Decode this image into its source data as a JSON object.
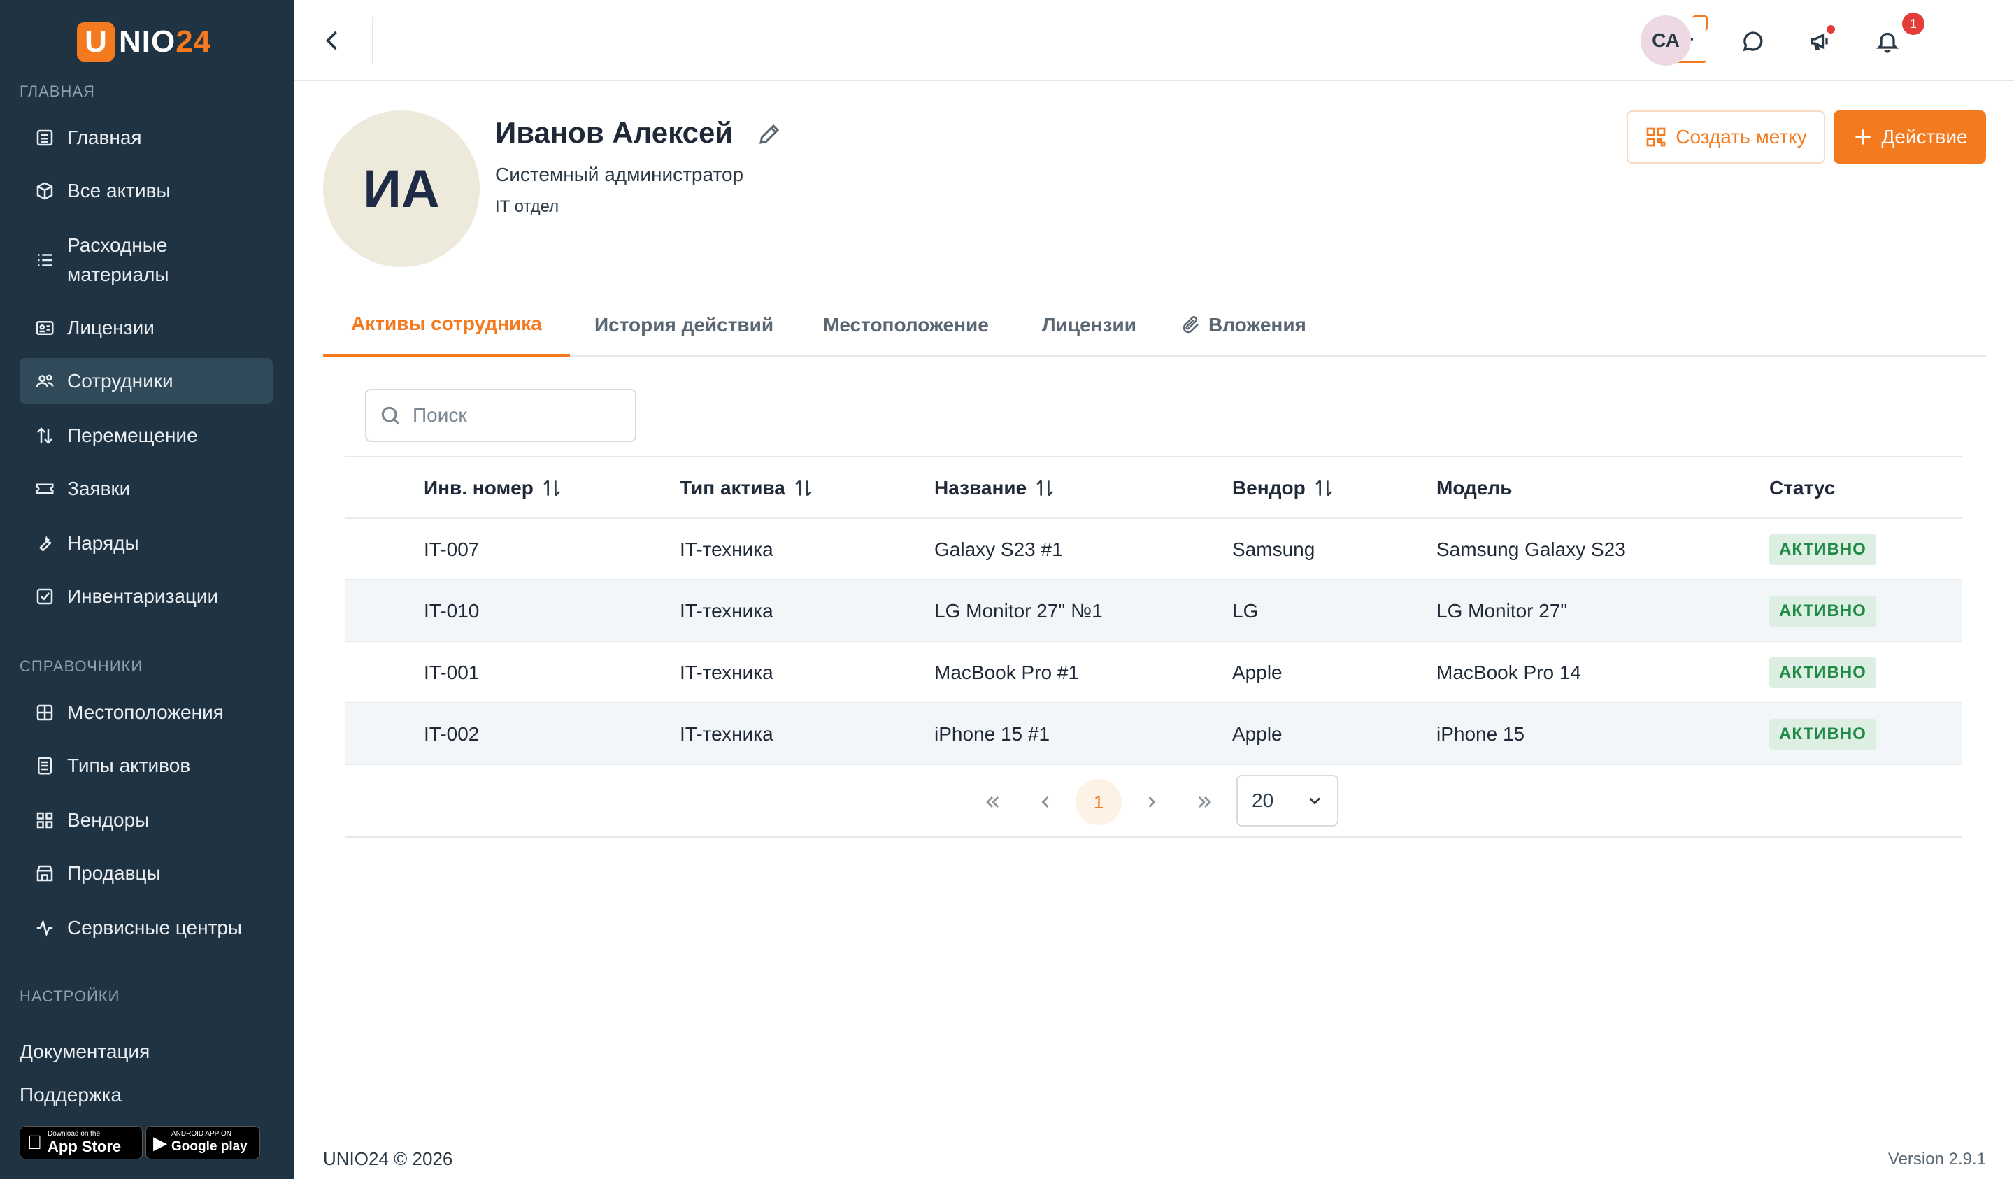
{
  "app": {
    "logo_letter": "U",
    "logo_rest": "NIO",
    "logo_num": "24"
  },
  "sidebar": {
    "section_main": "ГЛАВНАЯ",
    "section_refs": "СПРАВОЧНИКИ",
    "section_settings": "НАСТРОЙКИ",
    "main_items": [
      {
        "label": "Главная",
        "icon": "building-icon"
      },
      {
        "label": "Все активы",
        "icon": "box-icon"
      },
      {
        "label": "Расходные материалы",
        "icon": "list-icon"
      },
      {
        "label": "Лицензии",
        "icon": "license-icon"
      },
      {
        "label": "Сотрудники",
        "icon": "users-icon",
        "active": true
      },
      {
        "label": "Перемещение",
        "icon": "transfer-icon"
      },
      {
        "label": "Заявки",
        "icon": "ticket-icon"
      },
      {
        "label": "Наряды",
        "icon": "wrench-icon"
      },
      {
        "label": "Инвентаризации",
        "icon": "checkbox-icon"
      }
    ],
    "ref_items": [
      {
        "label": "Местоположения",
        "icon": "grid-icon"
      },
      {
        "label": "Типы активов",
        "icon": "document-icon"
      },
      {
        "label": "Вендоры",
        "icon": "tiles-icon"
      },
      {
        "label": "Продавцы",
        "icon": "store-icon"
      },
      {
        "label": "Сервисные центры",
        "icon": "activity-icon"
      }
    ],
    "docs_link": "Документация",
    "support_link": "Поддержка",
    "appstore_small": "Download on the",
    "appstore_big": "App Store",
    "googleplay_small": "ANDROID APP ON",
    "googleplay_big": "Google play"
  },
  "topbar": {
    "notification_count": "1",
    "user_initials": "СА"
  },
  "employee": {
    "initials": "ИА",
    "name": "Иванов Алексей",
    "position": "Системный администратор",
    "department": "IT отдел"
  },
  "actions": {
    "create_tag": "Создать метку",
    "action": "Действие"
  },
  "tabs": [
    {
      "label": "Активы сотрудника",
      "active": true
    },
    {
      "label": "История действий"
    },
    {
      "label": "Местоположение"
    },
    {
      "label": "Лицензии"
    },
    {
      "label": "Вложения"
    }
  ],
  "search": {
    "placeholder": "Поиск"
  },
  "table": {
    "headers": [
      "Инв. номер",
      "Тип актива",
      "Название",
      "Вендор",
      "Модель",
      "Статус"
    ],
    "rows": [
      {
        "inv": "IT-007",
        "type": "IT-техника",
        "name": "Galaxy S23 #1",
        "vendor": "Samsung",
        "model": "Samsung Galaxy S23",
        "status": "АКТИВНО"
      },
      {
        "inv": "IT-010",
        "type": "IT-техника",
        "name": "LG Monitor 27\" №1",
        "vendor": "LG",
        "model": "LG Monitor 27\"",
        "status": "АКТИВНО"
      },
      {
        "inv": "IT-001",
        "type": "IT-техника",
        "name": "MacBook Pro #1",
        "vendor": "Apple",
        "model": "MacBook Pro 14",
        "status": "АКТИВНО"
      },
      {
        "inv": "IT-002",
        "type": "IT-техника",
        "name": "iPhone 15 #1",
        "vendor": "Apple",
        "model": "iPhone 15",
        "status": "АКТИВНО"
      }
    ]
  },
  "pagination": {
    "current_page": "1",
    "page_size": "20"
  },
  "footer": {
    "copyright": "UNIO24 © 2026",
    "version": "Version 2.9.1"
  },
  "colors": {
    "accent": "#f47a1f",
    "sidebar": "#1f3342",
    "status_bg": "#dcefe2",
    "status_text": "#1f8a45"
  }
}
